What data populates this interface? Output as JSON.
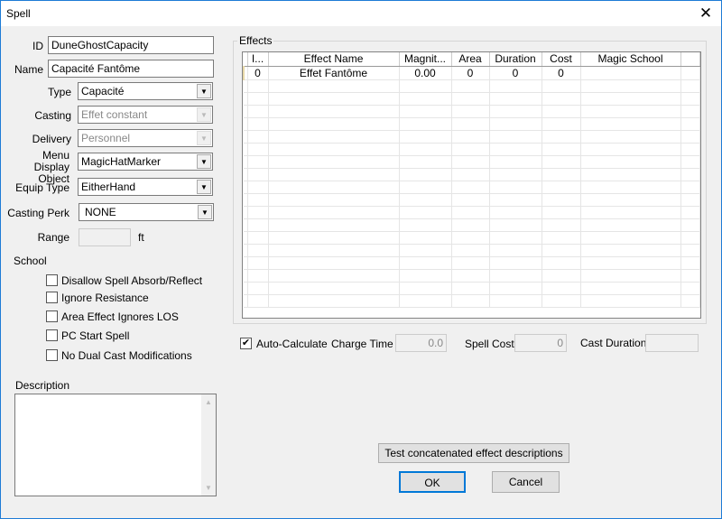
{
  "window": {
    "title": "Spell",
    "close": "✕"
  },
  "form": {
    "id_label": "ID",
    "id_value": "DuneGhostCapacity",
    "name_label": "Name",
    "name_value": "Capacité Fantôme",
    "type_label": "Type",
    "type_value": "Capacité",
    "casting_label": "Casting",
    "casting_value": "Effet constant",
    "delivery_label": "Delivery",
    "delivery_value": "Personnel",
    "menu_label": "Menu Display Object",
    "menu_value": "MagicHatMarker",
    "equip_label": "Equip Type",
    "equip_value": "EitherHand",
    "perk_label": "Casting Perk",
    "perk_value": "NONE",
    "range_label": "Range",
    "range_value": "",
    "range_unit": "ft",
    "school_label": "School",
    "checkboxes": [
      {
        "label": "Disallow Spell Absorb/Reflect",
        "checked": false
      },
      {
        "label": "Ignore Resistance",
        "checked": false
      },
      {
        "label": "Area Effect Ignores LOS",
        "checked": false
      },
      {
        "label": "PC Start Spell",
        "checked": false
      },
      {
        "label": "No Dual Cast Modifications",
        "checked": false
      }
    ],
    "description_label": "Description",
    "description_value": ""
  },
  "effects": {
    "label": "Effects",
    "columns": [
      "I...",
      "Effect Name",
      "Magnit...",
      "Area",
      "Duration",
      "Cost",
      "Magic School"
    ],
    "rows": [
      [
        "0",
        "Effet Fantôme",
        "0.00",
        "0",
        "0",
        "0",
        ""
      ]
    ]
  },
  "calc": {
    "auto_label": "Auto-Calculate",
    "auto_checked": true,
    "charge_label": "Charge Time",
    "charge_value": "0.0",
    "cost_label": "Spell Cost",
    "cost_value": "0",
    "duration_label": "Cast Duration",
    "duration_value": ""
  },
  "buttons": {
    "test": "Test concatenated effect descriptions",
    "ok": "OK",
    "cancel": "Cancel"
  }
}
